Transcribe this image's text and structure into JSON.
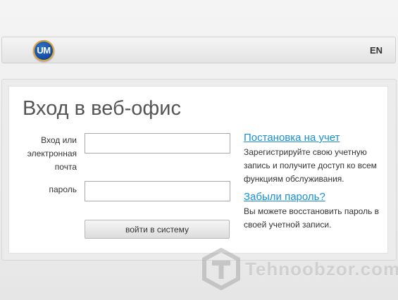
{
  "header": {
    "logo_text": "UM",
    "language": "EN"
  },
  "login_form": {
    "title": "Вход в веб-офис",
    "login_label": "Вход или электронная почта",
    "login_value": "",
    "password_label": "пароль",
    "password_value": "",
    "submit_label": "войти в систему"
  },
  "sidebar": {
    "register_link": "Постановка на учет",
    "register_text": "Зарегистрируйте свою учетную запись и получите доступ ко всем функциям обслуживания.",
    "forgot_link": "Забыли пароль?",
    "forgot_text": "Вы можете восстановить пароль в своей учетной записи."
  },
  "watermark": {
    "text": "Tehnoobzor.com"
  },
  "colors": {
    "link": "#1a8fd6",
    "logo_blue": "#1650a6",
    "logo_ring": "#e9a530"
  }
}
